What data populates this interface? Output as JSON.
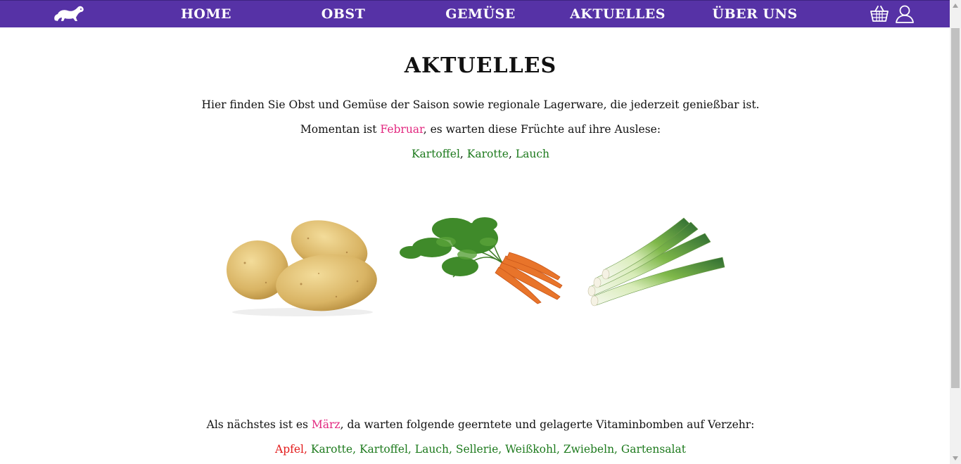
{
  "nav": {
    "items": [
      {
        "label": "HOME"
      },
      {
        "label": "OBST"
      },
      {
        "label": "GEMÜSE"
      },
      {
        "label": "AKTUELLES"
      },
      {
        "label": "ÜBER UNS"
      }
    ],
    "logo_icon": "ferret-logo-icon",
    "cart_icon": "basket-icon",
    "account_icon": "user-icon"
  },
  "main": {
    "title": "AKTUELLES",
    "intro": "Hier finden Sie Obst und Gemüse der Saison sowie regionale Lagerware, die jederzeit genießbar ist.",
    "current": {
      "prefix": "Momentan ist ",
      "month": "Februar",
      "suffix": ", es warten diese Früchte auf ihre Auslese:",
      "items": [
        "Kartoffel",
        "Karotte",
        "Lauch"
      ]
    },
    "next": {
      "prefix": "Als nächstes ist es ",
      "month": "März",
      "suffix": ", da warten folgende geerntete und gelagerte Vitaminbomben auf Verzehr:",
      "items": [
        {
          "name": "Apfel",
          "kind": "fruit"
        },
        {
          "name": "Karotte",
          "kind": "vegetable"
        },
        {
          "name": "Kartoffel",
          "kind": "vegetable"
        },
        {
          "name": "Lauch",
          "kind": "vegetable"
        },
        {
          "name": "Sellerie",
          "kind": "vegetable"
        },
        {
          "name": "Weißkohl",
          "kind": "vegetable"
        },
        {
          "name": "Zwiebeln",
          "kind": "vegetable"
        },
        {
          "name": "Gartensalat",
          "kind": "vegetable"
        }
      ]
    },
    "images": [
      "potato-image",
      "carrot-image",
      "leek-image"
    ]
  },
  "colors": {
    "nav_bg": "#5632a6",
    "month": "#e2277f",
    "vegetable": "#1d7a1d",
    "fruit": "#e31b1b"
  }
}
